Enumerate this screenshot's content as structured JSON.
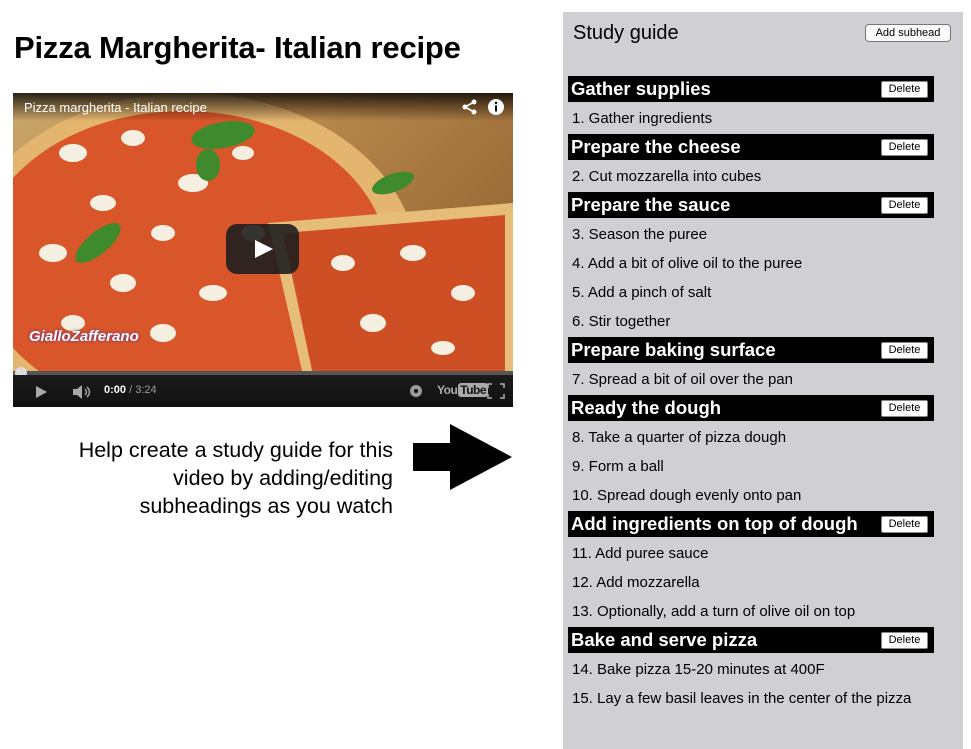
{
  "page_title": "Pizza Margherita- Italian recipe",
  "video": {
    "title": "Pizza margherita - Italian recipe",
    "current_time": "0:00",
    "separator": "/",
    "duration": "3:24",
    "progress_percent": 0,
    "logo_text": "GialloZafferano",
    "youtube_logo": {
      "you": "You",
      "tube": "Tube"
    },
    "icons": [
      "share-icon",
      "info-icon",
      "play-icon",
      "volume-icon",
      "settings-icon",
      "fullscreen-icon"
    ]
  },
  "instructions": {
    "line1": "Help create a study guide for this",
    "line2": "video by adding/editing",
    "line3": "subheadings as you watch"
  },
  "study_guide": {
    "title": "Study guide",
    "add_subhead_label": "Add subhead",
    "delete_label": "Delete",
    "sections": [
      {
        "heading": "Gather supplies",
        "steps": [
          "1. Gather ingredients"
        ]
      },
      {
        "heading": "Prepare the cheese",
        "steps": [
          "2. Cut mozzarella into cubes"
        ]
      },
      {
        "heading": "Prepare the sauce",
        "steps": [
          "3. Season the puree",
          "4. Add a bit of olive oil to the puree",
          "5. Add a pinch of salt",
          "6. Stir together"
        ]
      },
      {
        "heading": "Prepare baking surface",
        "steps": [
          "7. Spread a bit of oil over the pan"
        ]
      },
      {
        "heading": "Ready the dough",
        "steps": [
          "8. Take a quarter of pizza dough",
          "9. Form a ball",
          "10. Spread dough evenly onto pan"
        ]
      },
      {
        "heading": "Add ingredients on top of dough",
        "steps": [
          "11. Add puree sauce",
          "12. Add mozzarella",
          "13. Optionally, add a turn of olive oil on top"
        ]
      },
      {
        "heading": "Bake and serve pizza",
        "steps": [
          "14. Bake pizza 15-20 minutes at 400F",
          "15. Lay a few basil leaves in the center of the pizza"
        ]
      }
    ]
  },
  "colors": {
    "panel_bg": "#d0cfd4",
    "subhead_bg": "#000000",
    "subhead_text": "#ffffff"
  }
}
